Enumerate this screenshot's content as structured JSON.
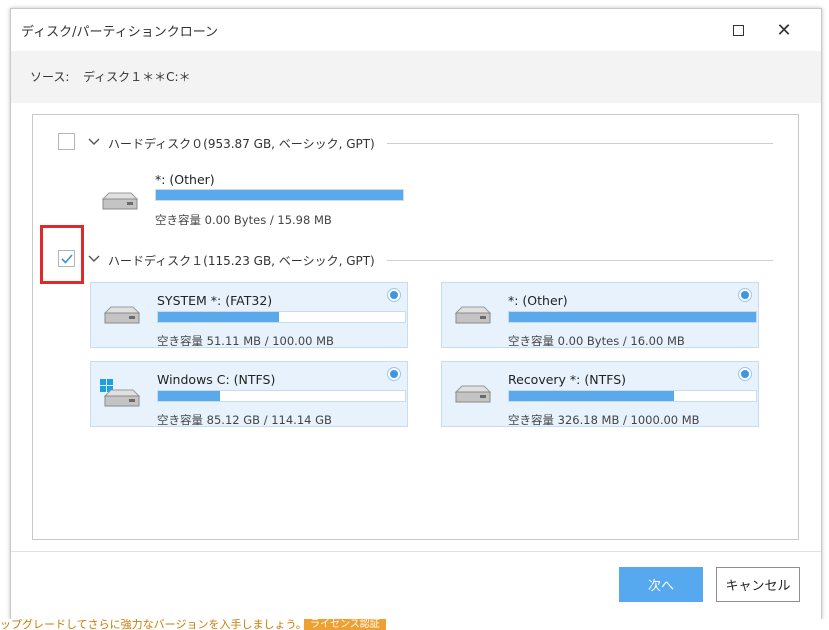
{
  "window": {
    "title": "ディスク/パーティションクローン"
  },
  "source": {
    "label": "ソース:",
    "value": "ディスク１＊＊C:＊"
  },
  "disks": [
    {
      "header": "ハードディスク０(953.87 GB, ベーシック, GPT)",
      "checked": false,
      "partitions": [
        {
          "name": "*: (Other)",
          "space": "空き容量 0.00 Bytes / 15.98 MB",
          "fill": 1.0
        }
      ]
    },
    {
      "header": "ハードディスク１(115.23 GB, ベーシック, GPT)",
      "checked": true,
      "partitions": [
        {
          "name": "SYSTEM *: (FAT32)",
          "space": "空き容量 51.11 MB / 100.00 MB",
          "fill": 0.49
        },
        {
          "name": "*: (Other)",
          "space": "空き容量 0.00 Bytes / 16.00 MB",
          "fill": 1.0
        },
        {
          "name": "Windows C: (NTFS)",
          "space": "空き容量 85.12 GB / 114.14 GB",
          "fill": 0.25
        },
        {
          "name": "Recovery *: (NTFS)",
          "space": "空き容量 326.18 MB / 1000.00 MB",
          "fill": 0.67
        }
      ]
    }
  ],
  "buttons": {
    "next": "次へ",
    "cancel": "キャンセル"
  },
  "bottom_banner": {
    "text": "ップグレードしてさらに強力なバージョンを入手しましょう。",
    "badge": "ライセンス認証"
  },
  "colors": {
    "accent": "#56a9ee",
    "highlight": "#dd2b2b",
    "card": "#e8f2fc"
  },
  "icons": [
    "maximize-icon",
    "close-icon",
    "chevron-down-icon",
    "checkmark-icon",
    "hard-drive-icon",
    "windows-logo-icon",
    "radio-selected-icon"
  ]
}
